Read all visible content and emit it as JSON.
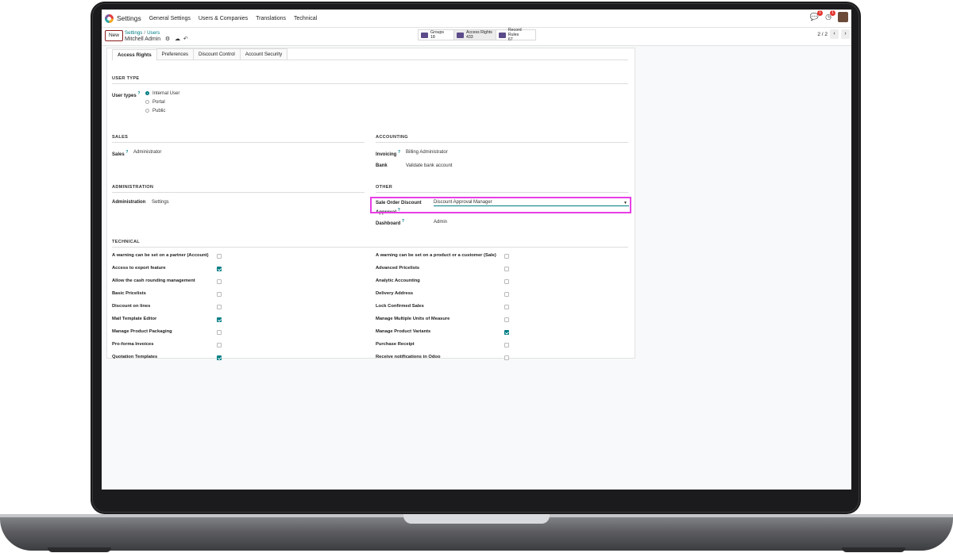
{
  "navbar": {
    "app_title": "Settings",
    "menu": [
      "General Settings",
      "Users & Companies",
      "Translations",
      "Technical"
    ],
    "messages_badge": "1",
    "activity_badge": "1"
  },
  "control_panel": {
    "new_label": "New",
    "breadcrumb": [
      "Settings",
      "Users"
    ],
    "record_name": "Mitchell Admin",
    "smart_buttons": [
      {
        "label": "Groups",
        "count": "18"
      },
      {
        "label": "Access Rights",
        "count": "433"
      },
      {
        "label": "Record Rules",
        "count": "67"
      }
    ],
    "pager": "2 / 2"
  },
  "tabs": [
    "Access Rights",
    "Preferences",
    "Discount Control",
    "Account Security"
  ],
  "user_type": {
    "section": "USER TYPE",
    "label": "User types",
    "options": [
      "Internal User",
      "Portal",
      "Public"
    ],
    "selected": "Internal User"
  },
  "sales": {
    "section": "SALES",
    "label": "Sales",
    "value": "Administrator"
  },
  "accounting": {
    "section": "ACCOUNTING",
    "invoicing_label": "Invoicing",
    "invoicing_value": "Billing Administrator",
    "bank_label": "Bank",
    "bank_value": "Validate bank account"
  },
  "administration": {
    "section": "ADMINISTRATION",
    "label": "Administration",
    "value": "Settings"
  },
  "other": {
    "section": "OTHER",
    "discount_label_1": "Sale Order Discount",
    "discount_label_2": "Approval",
    "discount_value": "Discount Approval Manager",
    "dashboard_label": "Dashboard",
    "dashboard_value": "Admin"
  },
  "technical": {
    "section": "TECHNICAL",
    "left": [
      {
        "label": "A warning can be set on a partner (Account)",
        "checked": false
      },
      {
        "label": "Access to export feature",
        "checked": true
      },
      {
        "label": "Allow the cash rounding management",
        "checked": false
      },
      {
        "label": "Basic Pricelists",
        "checked": false
      },
      {
        "label": "Discount on lines",
        "checked": false
      },
      {
        "label": "Mail Template Editor",
        "checked": true
      },
      {
        "label": "Manage Product Packaging",
        "checked": false
      },
      {
        "label": "Pro-forma Invoices",
        "checked": false
      },
      {
        "label": "Quotation Templates",
        "checked": true
      }
    ],
    "right": [
      {
        "label": "A warning can be set on a product or a customer (Sale)",
        "checked": false
      },
      {
        "label": "Advanced Pricelists",
        "checked": false
      },
      {
        "label": "Analytic Accounting",
        "checked": false
      },
      {
        "label": "Delivery Address",
        "checked": false
      },
      {
        "label": "Lock Confirmed Sales",
        "checked": false
      },
      {
        "label": "Manage Multiple Units of Measure",
        "checked": false
      },
      {
        "label": "Manage Product Variants",
        "checked": true
      },
      {
        "label": "Purchase Receipt",
        "checked": false
      },
      {
        "label": "Receive notifications in Odoo",
        "checked": false
      }
    ]
  },
  "colors": {
    "accent": "#017e84",
    "highlight": "#e83ee6",
    "new_border": "#8c1d1d"
  }
}
